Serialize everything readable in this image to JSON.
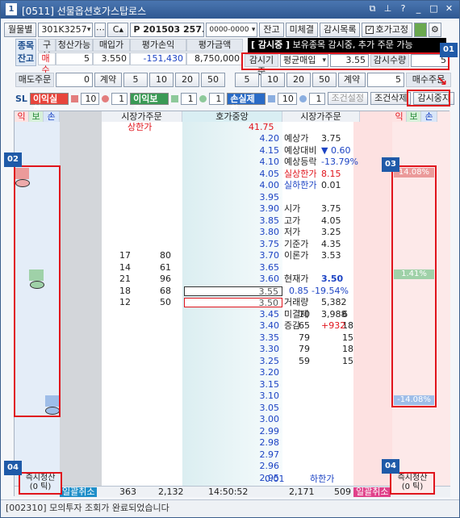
{
  "title": {
    "num": "1",
    "text": "[0511] 선물옵션호가스탑로스"
  },
  "toolbar": {
    "period": "월물별",
    "account": "301K3257",
    "code": "P 201503 257.5",
    "acctpw": "0000-0000",
    "btn_balance": "잔고",
    "btn_unfilled": "미체결",
    "btn_monlist": "감시목록",
    "fix_label": "호가고정"
  },
  "balance": {
    "tag": "종목잔고",
    "h_type": "구분",
    "h_qty": "청산가능",
    "h_price": "매입가",
    "h_pl": "평가손익",
    "h_eval": "평가금액",
    "v_type": "매수",
    "v_qty": "5",
    "v_price": "3.550",
    "v_pl": "-151,430",
    "v_eval": "8,750,000"
  },
  "notice": {
    "tag": "[ 감시중 ]",
    "text": "보유종목 감시중, 추가 주문 가능"
  },
  "monitor": {
    "basis_label": "감시기준",
    "basis_value": "평균매입",
    "price": "3.55",
    "qty_label": "감시수량",
    "qty": "5"
  },
  "sellorder": {
    "label": "매도주문",
    "qty": "0",
    "unit": "계약",
    "b1": "5",
    "b2": "10",
    "b3": "20",
    "b4": "50"
  },
  "buyorder": {
    "b1": "5",
    "b2": "10",
    "b3": "20",
    "b4": "50",
    "unit": "계약",
    "qty": "5",
    "label": "매수주문"
  },
  "sl": {
    "label": "SL",
    "profit": "이익실현",
    "profit_n": "10",
    "breakeven": "이익보존",
    "be_n": "1",
    "loss": "손실제한",
    "loss_n": "10",
    "extra_n": "1",
    "cond_set": "조건설정",
    "cond_del": "조건삭제",
    "stop": "감시중지"
  },
  "headers": {
    "ik": "익",
    "bo": "보",
    "son": "손",
    "market": "시장가주문",
    "center": "호가중앙",
    "market2": "시장가주문"
  },
  "limit_up": "상한가",
  "limit_up_price": "41.75",
  "prices": [
    "4.20",
    "4.15",
    "4.10",
    "4.05",
    "4.00",
    "3.95",
    "3.90",
    "3.85",
    "3.80",
    "3.75",
    "3.70",
    "3.65",
    "3.60",
    "3.55",
    "3.50",
    "3.45",
    "3.40",
    "3.35",
    "3.30",
    "3.25",
    "3.20",
    "3.15",
    "3.10",
    "3.05",
    "3.00",
    "2.99",
    "2.98",
    "2.97",
    "2.96",
    "2.95"
  ],
  "limit_down_price": "0.01",
  "limit_down": "하한가",
  "sell_qty": [
    [
      "17",
      "80"
    ],
    [
      "14",
      "61"
    ],
    [
      "21",
      "96"
    ],
    [
      "18",
      "68"
    ],
    [
      "12",
      "50"
    ]
  ],
  "buy_qty": [
    [
      "10",
      "6"
    ],
    [
      "65",
      "18"
    ],
    [
      "79",
      "15"
    ],
    [
      "79",
      "18"
    ],
    [
      "59",
      "15"
    ]
  ],
  "info": [
    [
      "예상가",
      "3.75"
    ],
    [
      "예상대비",
      "▼ 0.60"
    ],
    [
      "예상등락",
      "-13.79%"
    ],
    [
      "실상한가",
      "8.15"
    ],
    [
      "실하한가",
      "0.01"
    ],
    [
      "",
      ""
    ],
    [
      "시가",
      "3.75"
    ],
    [
      "고가",
      "4.05"
    ],
    [
      "저가",
      "3.25"
    ],
    [
      "기준가",
      "4.35"
    ],
    [
      "이론가",
      "3.53"
    ],
    [
      "",
      ""
    ],
    [
      "현재가",
      "3.50"
    ],
    [
      "",
      "0.85 -19.54%"
    ],
    [
      "거래량",
      "5,382"
    ],
    [
      "미결제",
      "3,988"
    ],
    [
      "증감",
      "+932"
    ]
  ],
  "markers": {
    "m1": "14.08%",
    "m2": "1.41%",
    "m3": "-14.08%"
  },
  "bottom": {
    "liq_left": "즉시청산\n(0 틱)",
    "liq_right": "즉시청산\n(0 틱)",
    "cancel_l": "일괄취소",
    "tot1": "363",
    "tot2": "2,132",
    "time": "14:50:52",
    "tot3": "2,171",
    "tot4": "509",
    "cancel_r": "일괄취소"
  },
  "badges": {
    "b1": "01",
    "b2": "02",
    "b3": "03",
    "b4": "04",
    "b5": "04"
  },
  "status": "[002310] 모의투자 조회가 완료되었습니다"
}
